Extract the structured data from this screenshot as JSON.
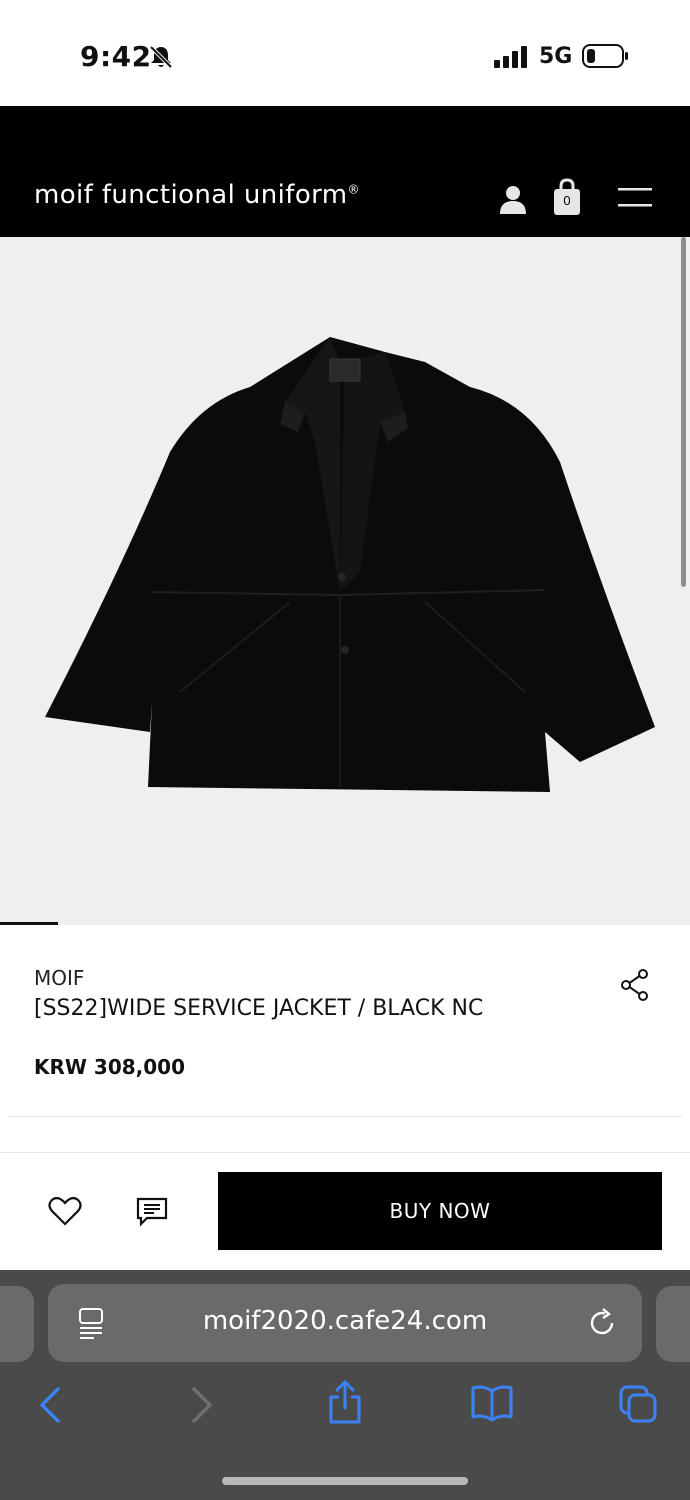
{
  "status_bar": {
    "time": "9:42",
    "network": "5G"
  },
  "header": {
    "brand": "moif functional uniform",
    "brand_mark": "®",
    "cart_count": "0"
  },
  "product": {
    "brand": "MOIF",
    "title": "[SS22]WIDE SERVICE JACKET / BLACK NC",
    "price": "KRW 308,000",
    "image_alt": "[SS22]WIDE SERVICE JACKET / BLACK NC"
  },
  "actions": {
    "buy_label": "BUY NOW"
  },
  "browser": {
    "url": "moif2020.cafe24.com"
  },
  "colors": {
    "header_bg": "#000000",
    "hero_bg": "#efefef",
    "buy_bg": "#000000",
    "safari_toolbar": "#4a4a4a",
    "safari_accent": "#3b82f6"
  },
  "icons": [
    "bell-slash-icon",
    "signal-icon",
    "battery-icon",
    "user-icon",
    "cart-icon",
    "menu-icon",
    "share-icon",
    "heart-icon",
    "review-icon",
    "reader-icon",
    "reload-icon",
    "back-icon",
    "forward-icon",
    "share-safari-icon",
    "bookmarks-icon",
    "tabs-icon"
  ]
}
